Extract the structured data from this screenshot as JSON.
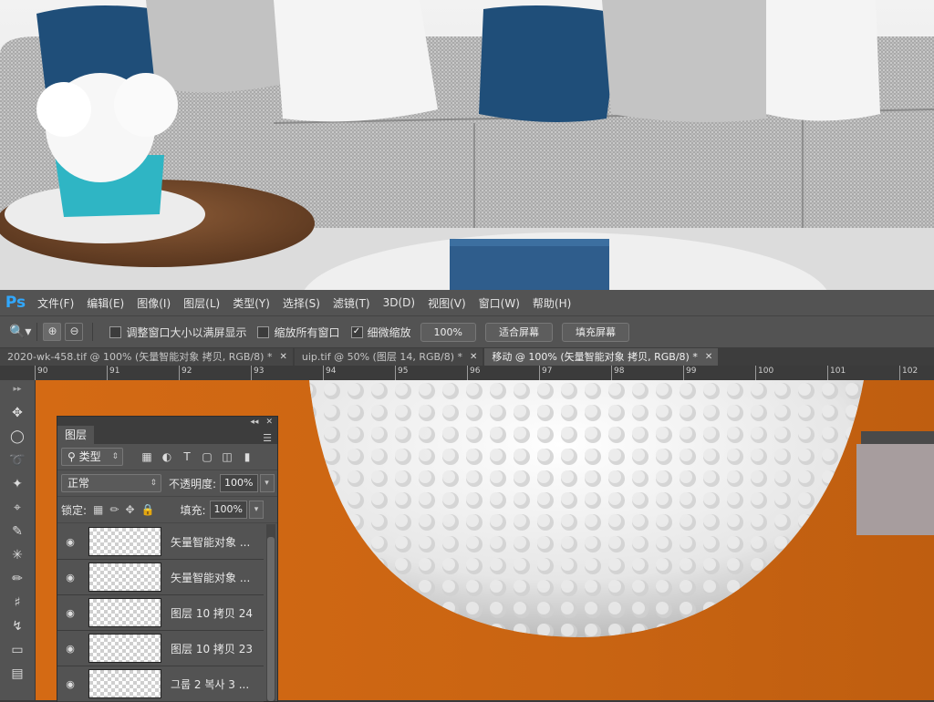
{
  "app": {
    "logo": "Ps"
  },
  "menu": [
    "文件(F)",
    "编辑(E)",
    "图像(I)",
    "图层(L)",
    "类型(Y)",
    "选择(S)",
    "滤镜(T)",
    "3D(D)",
    "视图(V)",
    "窗口(W)",
    "帮助(H)"
  ],
  "options": {
    "tool_icon": "zoom-icon",
    "zoom_in": "⊕",
    "zoom_out": "⊖",
    "resize_windows": "调整窗口大小以满屏显示",
    "zoom_all": "缩放所有窗口",
    "scrubby": "细微缩放",
    "scrubby_checked": true,
    "btn_100": "100%",
    "btn_fit": "适合屏幕",
    "btn_fill": "填充屏幕"
  },
  "tabs": [
    {
      "label": "2020-wk-458.tif @ 100% (矢量智能对象 拷贝, RGB/8) *",
      "active": false
    },
    {
      "label": "uip.tif @ 50% (图层 14, RGB/8) *",
      "active": false
    },
    {
      "label": "移动 @ 100% (矢量智能对象 拷贝, RGB/8) *",
      "active": true
    }
  ],
  "ruler": [
    "90",
    "91",
    "92",
    "93",
    "94",
    "95",
    "96",
    "97",
    "98",
    "99",
    "100",
    "101",
    "102"
  ],
  "layers_panel": {
    "title": "图层",
    "filter_kind": "类型",
    "blend_mode": "正常",
    "opacity_label": "不透明度:",
    "opacity": "100%",
    "lock_label": "锁定:",
    "fill_label": "填充:",
    "fill": "100%",
    "layers": [
      {
        "name": "矢量智能对象 ...",
        "visible": true
      },
      {
        "name": "矢量智能对象 ...",
        "visible": true
      },
      {
        "name": "图层 10 拷贝 24",
        "visible": true
      },
      {
        "name": "图层 10 拷贝 23",
        "visible": true
      },
      {
        "name": "그룹 2 복사 3 ...",
        "visible": true
      }
    ]
  },
  "colors": {
    "canvas": "#d26a14",
    "ps_blue": "#31a8ff",
    "ui_bg": "#535353"
  }
}
